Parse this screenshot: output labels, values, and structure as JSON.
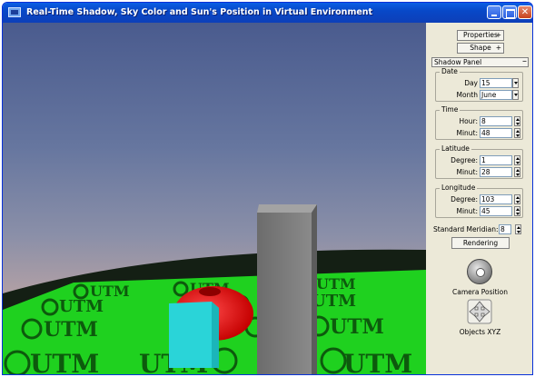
{
  "window": {
    "title": "Real-Time Shadow, Sky Color and Sun's Position in Virtual Environment"
  },
  "panel": {
    "properties_label": "Properties",
    "shape_label": "Shape",
    "plus": "+",
    "shadow_panel_label": "Shadow Panel",
    "minus": "–",
    "date": {
      "label": "Date",
      "day_label": "Day",
      "day_value": "15",
      "month_label": "Month",
      "month_value": "June"
    },
    "time": {
      "label": "Time",
      "hour_label": "Hour:",
      "hour_value": "8",
      "minute_label": "Minut:",
      "minute_value": "48"
    },
    "latitude": {
      "label": "Latitude",
      "degree_label": "Degree:",
      "degree_value": "1",
      "minute_label": "Minut:",
      "minute_value": "28"
    },
    "longitude": {
      "label": "Longitude",
      "degree_label": "Degree:",
      "degree_value": "103",
      "minute_label": "Minut:",
      "minute_value": "45"
    },
    "standard_meridian_label": "Standard Meridian:",
    "standard_meridian_value": "8",
    "rendering_label": "Rendering",
    "camera_position_label": "Camera Position",
    "objects_xyz_label": "Objects XYZ"
  },
  "scene": {
    "ground_text": "UTM",
    "colors": {
      "ground": "#1fd11f",
      "pillar": "#7a7a7a",
      "torus": "#ff1a1a",
      "cube": "#2ad4d8"
    }
  },
  "icons": [
    "app-icon",
    "minimize-icon",
    "maximize-icon",
    "close-icon",
    "camera-position-icon",
    "move-arrows-icon"
  ]
}
